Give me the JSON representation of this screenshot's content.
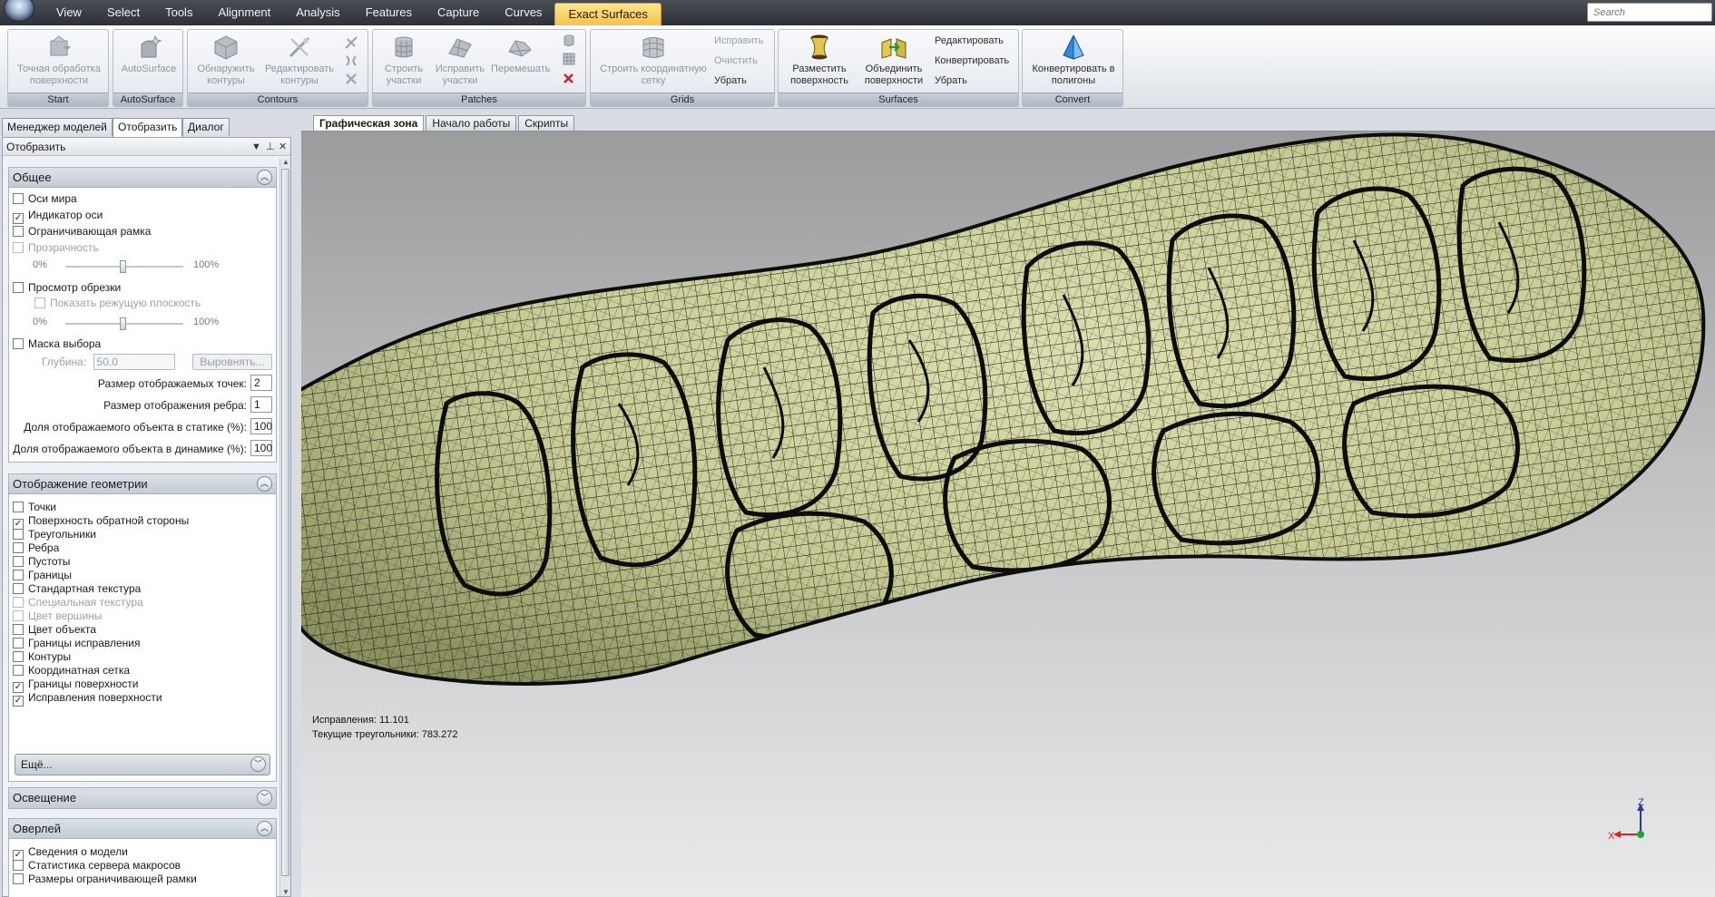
{
  "menu": {
    "items": [
      "View",
      "Select",
      "Tools",
      "Alignment",
      "Analysis",
      "Features",
      "Capture",
      "Curves"
    ],
    "active_tab": "Exact Surfaces",
    "search_placeholder": "Search"
  },
  "ribbon": {
    "start": {
      "caption": "Start",
      "precise_btn": "Точная обработка поверхности"
    },
    "autosurface": {
      "caption": "AutoSurface",
      "btn": "AutoSurface"
    },
    "contours": {
      "caption": "Contours",
      "detect_btn": "Обнаружить контуры",
      "edit_btn": "Редактировать контуры"
    },
    "patches": {
      "caption": "Patches",
      "build_btn": "Строить участки",
      "fix_btn": "Исправить участки",
      "shuffle_btn": "Перемешать"
    },
    "grids": {
      "caption": "Grids",
      "build_grid_btn": "Строить координатную сетку",
      "repair": "Исправить",
      "clear": "Очистить",
      "remove": "Убрать"
    },
    "surfaces": {
      "caption": "Surfaces",
      "place_btn": "Разместить поверхность",
      "merge_btn": "Объединить поверхности",
      "edit": "Редактировать",
      "convert": "Конвертировать",
      "remove": "Убрать"
    },
    "convert": {
      "caption": "Convert",
      "btn": "Конвертировать в полигоны"
    }
  },
  "panel": {
    "tabs": [
      "Менеджер моделей",
      "Отобразить",
      "Диалог"
    ],
    "title": "Отобразить",
    "general": {
      "title": "Общее",
      "world_axes": {
        "label": "Оси мира",
        "checked": false
      },
      "axis_indicator": {
        "label": "Индикатор оси",
        "checked": true
      },
      "bounding_box": {
        "label": "Ограничивающая рамка",
        "checked": false
      },
      "transparency": {
        "label": "Прозрачность",
        "checked": false,
        "min": "0%",
        "max": "100%",
        "value": 0.5
      },
      "clip_view": {
        "label": "Просмотр обрезки",
        "checked": false
      },
      "show_plane": {
        "label": "Показать режущую плоскость",
        "checked": false,
        "min": "0%",
        "max": "100%",
        "value": 0.5
      },
      "selection_mask": {
        "label": "Маска выбора",
        "checked": false
      },
      "depth_label": "Глубина:",
      "depth_value": "50.0",
      "align_btn": "Выровнять...",
      "point_size_label": "Размер отображаемых точек:",
      "point_size_value": "2",
      "edge_size_label": "Размер отображения ребра:",
      "edge_size_value": "1",
      "static_label": "Доля отображаемого объекта в статике (%):",
      "static_value": "100",
      "dynamic_label": "Доля отображаемого объекта в динамике (%):",
      "dynamic_value": "100"
    },
    "geometry": {
      "title": "Отображение геометрии",
      "items": [
        {
          "label": "Точки",
          "checked": false,
          "disabled": false
        },
        {
          "label": "Поверхность обратной стороны",
          "checked": true,
          "disabled": false
        },
        {
          "label": "Треугольники",
          "checked": false,
          "disabled": false
        },
        {
          "label": "Ребра",
          "checked": false,
          "disabled": false
        },
        {
          "label": "Пустоты",
          "checked": false,
          "disabled": false
        },
        {
          "label": "Границы",
          "checked": false,
          "disabled": false
        },
        {
          "label": "Стандартная текстура",
          "checked": false,
          "disabled": false
        },
        {
          "label": "Специальная текстура",
          "checked": false,
          "disabled": true
        },
        {
          "label": "Цвет вершины",
          "checked": false,
          "disabled": true
        },
        {
          "label": "Цвет объекта",
          "checked": false,
          "disabled": false
        },
        {
          "label": "Границы исправления",
          "checked": false,
          "disabled": false
        },
        {
          "label": "Контуры",
          "checked": false,
          "disabled": false
        },
        {
          "label": "Координатная сетка",
          "checked": false,
          "disabled": false
        },
        {
          "label": "Границы поверхности",
          "checked": true,
          "disabled": false
        },
        {
          "label": "Исправления поверхности",
          "checked": true,
          "disabled": false
        }
      ],
      "more_label": "Ещё..."
    },
    "lighting": {
      "title": "Освещение"
    },
    "overlay": {
      "title": "Оверлей",
      "items": [
        {
          "label": "Сведения о модели",
          "checked": true
        },
        {
          "label": "Статистика сервера макросов",
          "checked": false
        },
        {
          "label": "Размеры ограничивающей рамки",
          "checked": false
        }
      ]
    }
  },
  "viewport": {
    "tabs": [
      "Графическая зона",
      "Начало работы",
      "Скрипты"
    ],
    "fixes_label": "Исправления: 11.101",
    "triangles_label": "Текущие треугольники: 783.272",
    "axis_x": "X",
    "axis_z": "Z"
  },
  "colors": {
    "surface_fill": "#c9cd97",
    "mesh_line": "#111111",
    "active_tab": "#f5c24c",
    "axis_x": "#e02020",
    "axis_z": "#2a3aa8",
    "axis_y": "#1aa63a"
  }
}
